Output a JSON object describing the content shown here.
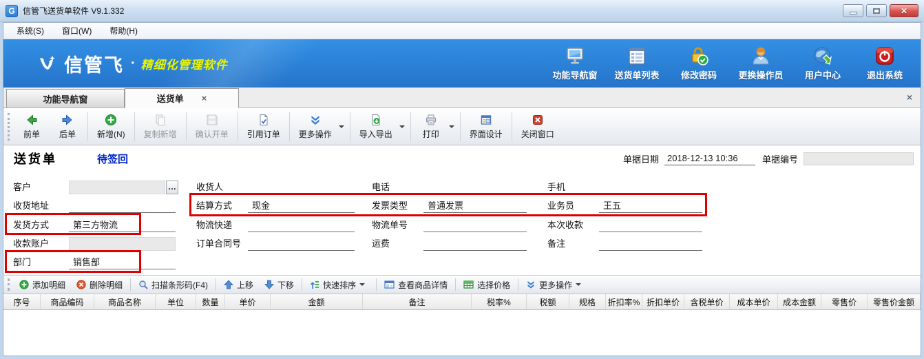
{
  "titlebar": {
    "title": "信管飞送货单软件 V9.1.332",
    "close_glyph": "✕"
  },
  "menubar": {
    "items": [
      "系统(S)",
      "窗口(W)",
      "帮助(H)"
    ]
  },
  "banner": {
    "logo": "信管飞",
    "dot": "·",
    "tagline": "精细化管理软件",
    "actions": [
      {
        "label": "功能导航窗",
        "icon": "monitor-icon"
      },
      {
        "label": "送货单列表",
        "icon": "list-icon"
      },
      {
        "label": "修改密码",
        "icon": "lock-icon"
      },
      {
        "label": "更换操作员",
        "icon": "user-icon"
      },
      {
        "label": "用户中心",
        "icon": "globe-icon"
      },
      {
        "label": "退出系统",
        "icon": "power-icon"
      }
    ]
  },
  "tabbar": {
    "tabs": [
      {
        "label": "功能导航窗",
        "active": false
      },
      {
        "label": "送货单",
        "active": true,
        "close_glyph": "×"
      }
    ],
    "close_all_glyph": "×"
  },
  "toolbar": {
    "buttons": [
      {
        "label": "前单",
        "icon": "arrow-left-icon"
      },
      {
        "label": "后单",
        "icon": "arrow-right-icon"
      },
      {
        "label": "新增(N)",
        "icon": "add-icon"
      },
      {
        "label": "复制新增",
        "icon": "copy-icon",
        "disabled": true
      },
      {
        "label": "确认开单",
        "icon": "save-icon",
        "disabled": true
      },
      {
        "label": "引用订单",
        "icon": "document-check-icon"
      },
      {
        "label": "更多操作",
        "icon": "chevrons-down-icon",
        "dropdown": true
      },
      {
        "label": "导入导出",
        "icon": "import-export-icon",
        "dropdown": true
      },
      {
        "label": "打印",
        "icon": "printer-icon",
        "dropdown": true
      },
      {
        "label": "界面设计",
        "icon": "layout-design-icon"
      },
      {
        "label": "关闭窗口",
        "icon": "close-window-icon"
      }
    ]
  },
  "doc": {
    "title": "送货单",
    "status": "待签回",
    "date_label": "单据日期",
    "date_value": "2018-12-13 10:36",
    "no_label": "单据编号",
    "no_value": ""
  },
  "form": {
    "customer": {
      "label": "客户",
      "value": "",
      "more_glyph": "…"
    },
    "address": {
      "label": "收货地址",
      "value": ""
    },
    "ship_method": {
      "label": "发货方式",
      "value": "第三方物流",
      "highlighted": true
    },
    "account": {
      "label": "收款账户",
      "value": ""
    },
    "department": {
      "label": "部门",
      "value": "销售部",
      "highlighted": true
    },
    "receiver": {
      "label": "收货人",
      "value": ""
    },
    "settlement": {
      "label": "结算方式",
      "value": "现金",
      "highlighted": true
    },
    "logistics": {
      "label": "物流快递",
      "value": ""
    },
    "contract_no": {
      "label": "订单合同号",
      "value": ""
    },
    "phone": {
      "label": "电话",
      "value": ""
    },
    "invoice_type": {
      "label": "发票类型",
      "value": "普通发票",
      "highlighted": true
    },
    "tracking_no": {
      "label": "物流单号",
      "value": ""
    },
    "freight": {
      "label": "运费",
      "value": ""
    },
    "mobile": {
      "label": "手机",
      "value": ""
    },
    "salesman": {
      "label": "业务员",
      "value": "王五",
      "highlighted": true
    },
    "payment": {
      "label": "本次收款",
      "value": ""
    },
    "remark": {
      "label": "备注",
      "value": ""
    }
  },
  "detail_toolbar": {
    "buttons": [
      {
        "label": "添加明细",
        "icon": "add-circle-icon"
      },
      {
        "label": "删除明细",
        "icon": "delete-circle-icon"
      },
      {
        "label": "扫描条形码(F4)",
        "icon": "barcode-scan-icon"
      },
      {
        "label": "上移",
        "icon": "move-up-icon"
      },
      {
        "label": "下移",
        "icon": "move-down-icon"
      },
      {
        "label": "快速排序",
        "icon": "sort-icon",
        "dropdown": true
      },
      {
        "label": "查看商品详情",
        "icon": "product-detail-icon"
      },
      {
        "label": "选择价格",
        "icon": "price-table-icon"
      },
      {
        "label": "更多操作",
        "icon": "chevrons-down-icon",
        "dropdown": true
      }
    ]
  },
  "grid": {
    "headers": [
      "序号",
      "商品编码",
      "商品名称",
      "单位",
      "数量",
      "单价",
      "金额",
      "备注",
      "税率%",
      "税额",
      "规格",
      "折扣率%",
      "折扣单价",
      "含税单价",
      "成本单价",
      "成本金额",
      "零售价",
      "零售价金额"
    ],
    "rows": []
  },
  "colors": {
    "banner_blue": "#2b85dc",
    "highlight_red": "#e10000",
    "status_text_blue": "#0024cc",
    "tagline_yellow": "#eaf400"
  }
}
